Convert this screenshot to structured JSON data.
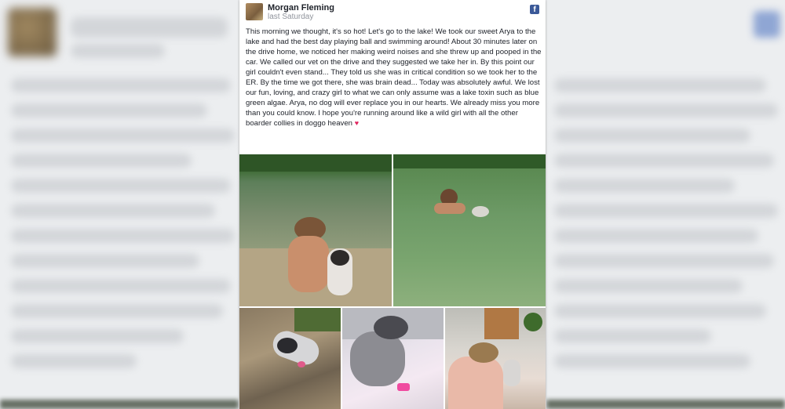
{
  "post": {
    "author": "Morgan Fleming",
    "timestamp": "last Saturday",
    "network_icon": "facebook-icon",
    "body": "This morning we thought, it's so hot! Let's go to the lake! We took our sweet Arya to the lake and had the best day playing ball and swimming around! About 30 minutes later on the drive home, we noticed her making weird noises and she threw up and pooped in the car. We called our vet on the drive and they suggested we take her in. By this point our girl couldn't even stand... They told us she was in critical condition so we took her to the ER. By the time we got there, she was brain dead... Today was absolutely awful. We lost our fun, loving, and crazy girl to what we can only assume was a lake toxin such as blue green algae. Arya, no dog will ever replace you in our hearts. We already miss you more than you could know. I hope you're running around like a wild girl with all the other boarder collies in doggo heaven",
    "emoji": "♥"
  },
  "colors": {
    "facebook_blue": "#3b5998",
    "heart_red": "#e0245e",
    "name_text": "#1d2129",
    "meta_text": "#90949c"
  }
}
